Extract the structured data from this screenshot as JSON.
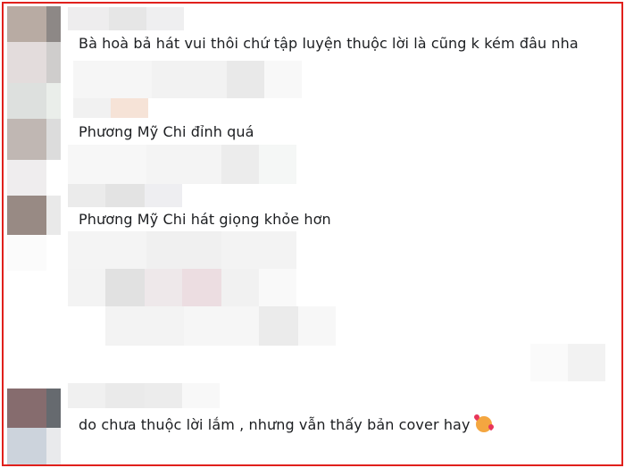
{
  "comments": [
    {
      "text": "Bà hoà bả hát vui thôi chứ tập luyện thuộc lời là cũng k kém đâu nha"
    },
    {
      "text": "Phương Mỹ Chi đỉnh quá"
    },
    {
      "text": "Phương Mỹ Chi hát giọng khỏe hơn"
    },
    {
      "text": "do chưa thuộc lời lắm , nhưng vẫn thấy bản cover hay",
      "emoji": "smiling-face-with-hearts-icon"
    }
  ],
  "colors": {
    "border": "#e0201c",
    "text": "#1c1e21",
    "blur_light": "#f0f0f0"
  }
}
